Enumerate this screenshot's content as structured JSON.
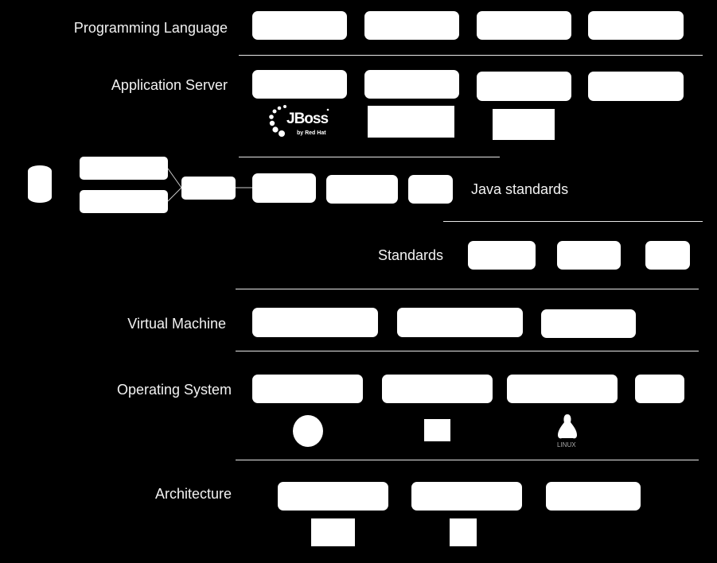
{
  "layers": {
    "programming_language": {
      "label": "Programming Language",
      "items": 4
    },
    "application_server": {
      "label": "Application Server",
      "items": 4,
      "logos": [
        "jboss-logo",
        "server-logo-2",
        "server-logo-3"
      ]
    },
    "java_standards": {
      "label": "Java standards",
      "items": 3
    },
    "standards": {
      "label": "Standards",
      "items": 3
    },
    "virtual_machine": {
      "label": "Virtual Machine",
      "items": 3
    },
    "operating_system": {
      "label": "Operating System",
      "items": 4,
      "logos": [
        "os-logo-circle",
        "os-logo-window",
        "linux-logo"
      ]
    },
    "architecture": {
      "label": "Architecture",
      "items": 3,
      "logos": [
        "arch-logo-1",
        "arch-logo-2"
      ]
    }
  },
  "logos": {
    "jboss_text": "JBoss",
    "jboss_sub": "by Red Hat",
    "linux_text": "LINUX"
  },
  "colors": {
    "background": "#000000",
    "foreground": "#ffffff"
  }
}
